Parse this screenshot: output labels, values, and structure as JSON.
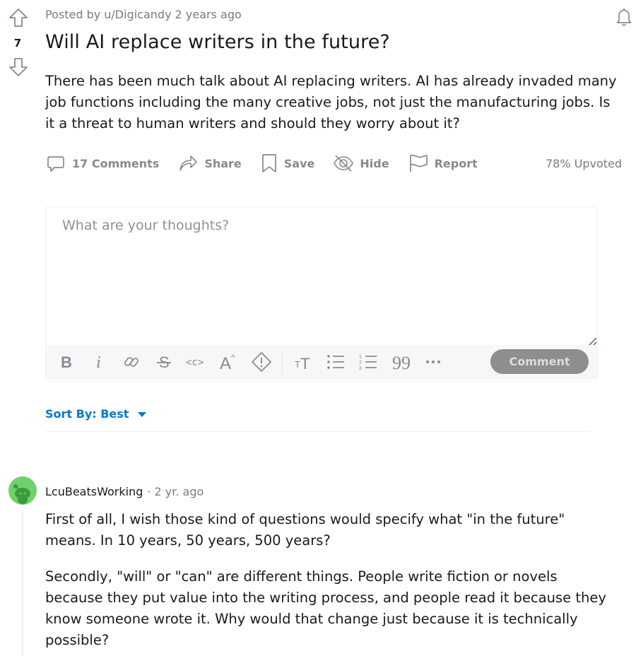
{
  "post": {
    "score": "7",
    "posted_by": "Posted by u/Digicandy 2 years ago",
    "title": "Will AI replace writers in the future?",
    "body": "There has been much talk about AI replacing writers. AI has already invaded many job functions including the many creative jobs, not just the manufacturing jobs. Is it a threat to human writers and should they worry about it?",
    "icons": [
      "upvote-arrow-icon",
      "downvote-arrow-icon",
      "bell-icon"
    ]
  },
  "actions": {
    "comments": "17 Comments",
    "share": "Share",
    "save": "Save",
    "hide": "Hide",
    "report": "Report",
    "upvoted": "78% Upvoted"
  },
  "composer": {
    "placeholder": "What are your thoughts?",
    "comment_button": "Comment",
    "tools": [
      "bold",
      "italic",
      "link",
      "strikethrough",
      "inline-code",
      "superscript",
      "spoiler",
      "heading",
      "bulleted-list",
      "numbered-list",
      "quote",
      "more"
    ]
  },
  "sort": {
    "label": "Sort By: Best"
  },
  "comments": [
    {
      "author": "LcuBeatsWorking",
      "time": "· 2 yr. ago",
      "paragraphs": [
        "First of all, I wish those kind of questions would specify what \"in the future\" means. In 10 years, 50 years, 500 years?",
        "Secondly, \"will\" or \"can\" are different things. People write fiction or novels because they put value into the writing process, and people read it because they know someone wrote it. Why would that change just because it is technically possible?"
      ]
    }
  ],
  "colors": {
    "text": "#1a1a1b",
    "meta": "#787c7e",
    "icon": "#878a8c",
    "link_blue": "#0079d3",
    "avatar_green": "#6fd06e",
    "button_disabled": "#8e8e8e"
  }
}
